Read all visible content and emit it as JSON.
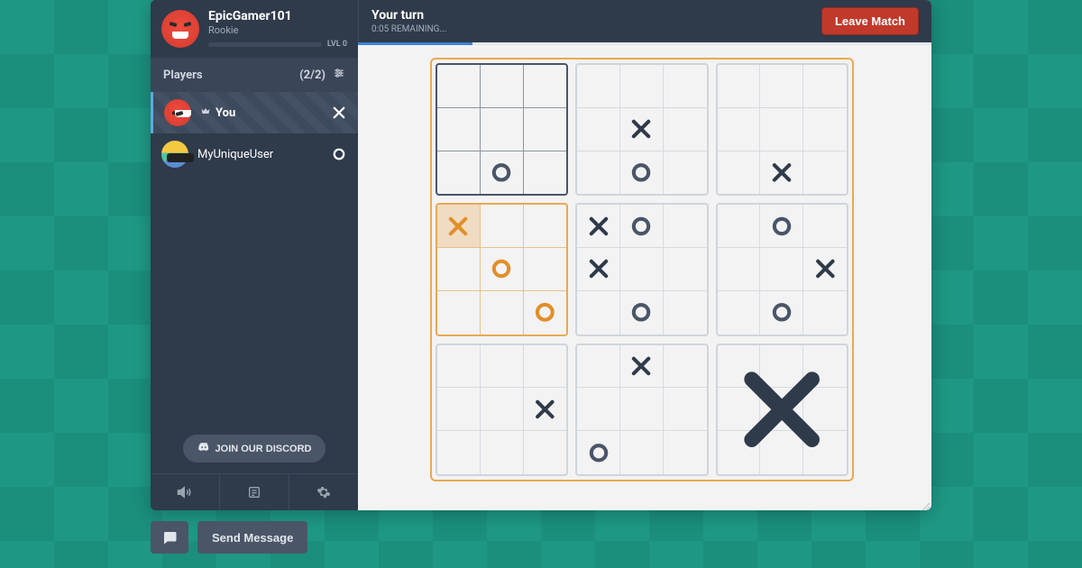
{
  "profile": {
    "name": "EpicGamer101",
    "rank": "Rookie",
    "level_label": "LVL 0"
  },
  "players_header": {
    "title": "Players",
    "count": "(2/2)"
  },
  "players": [
    {
      "label": "You",
      "is_you": true,
      "mark": "X"
    },
    {
      "label": "MyUniqueUser",
      "is_you": false,
      "mark": "O"
    }
  ],
  "discord_label": "JOIN OUR DISCORD",
  "turn": {
    "title": "Your turn",
    "remaining": "0:05 REMAINING..."
  },
  "leave_label": "Leave Match",
  "send_message_label": "Send Message",
  "board": {
    "active_sub": 3,
    "highlight_cell": [
      3,
      0
    ],
    "subs": [
      {
        "style": "dark",
        "won": null,
        "cells": [
          "",
          "",
          "",
          "",
          "",
          "",
          "",
          "O",
          ""
        ]
      },
      {
        "style": "normal",
        "won": null,
        "cells": [
          "",
          "",
          "",
          "",
          "X",
          "",
          "",
          "O",
          ""
        ]
      },
      {
        "style": "normal",
        "won": null,
        "cells": [
          "",
          "",
          "",
          "",
          "",
          "",
          "",
          "X",
          ""
        ]
      },
      {
        "style": "orange",
        "won": null,
        "cells": [
          "X",
          "",
          "",
          "",
          "O",
          "",
          "",
          "",
          "O"
        ]
      },
      {
        "style": "normal",
        "won": null,
        "cells": [
          "X",
          "O",
          "",
          "X",
          "",
          "",
          "",
          "O",
          ""
        ]
      },
      {
        "style": "normal",
        "won": null,
        "cells": [
          "",
          "O",
          "",
          "",
          "",
          "X",
          "",
          "O",
          ""
        ]
      },
      {
        "style": "normal",
        "won": null,
        "cells": [
          "",
          "",
          "",
          "",
          "",
          "X",
          "",
          "",
          ""
        ]
      },
      {
        "style": "normal",
        "won": null,
        "cells": [
          "",
          "X",
          "",
          "",
          "",
          "",
          "O",
          "",
          ""
        ]
      },
      {
        "style": "normal",
        "won": "X",
        "cells": [
          "",
          "",
          "",
          "",
          "",
          "",
          "",
          "",
          ""
        ]
      }
    ]
  },
  "colors": {
    "x": "#2f3a4a",
    "o_dark": "#4a5568",
    "o_orange": "#e28f2a",
    "x_orange": "#e28f2a"
  }
}
